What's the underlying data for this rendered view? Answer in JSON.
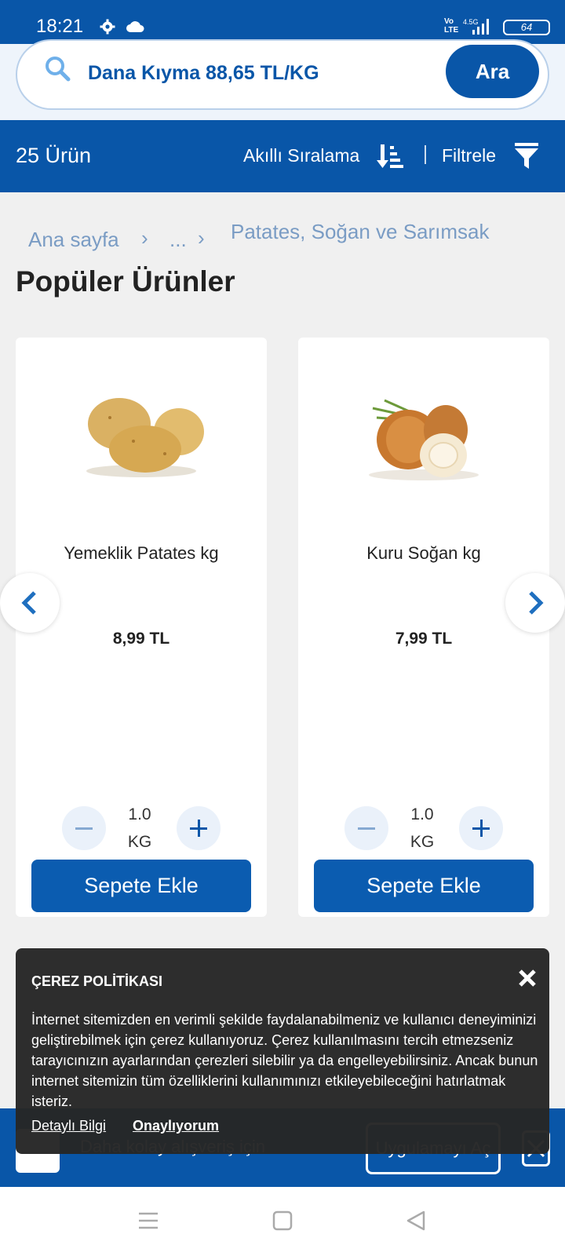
{
  "status": {
    "time": "18:21",
    "volte_top": "Vo",
    "volte_bottom": "LTE",
    "network": "4.5G",
    "battery": "64"
  },
  "search": {
    "query": "Dana Kıyma 88,65 TL/KG",
    "button": "Ara"
  },
  "toolbar": {
    "count": "25 Ürün",
    "sort": "Akıllı Sıralama",
    "filter": "Filtrele"
  },
  "breadcrumb": {
    "home": "Ana sayfa",
    "ellipsis": "...",
    "current": "Patates, Soğan ve Sarımsak"
  },
  "section_title": "Popüler Ürünler",
  "products": [
    {
      "name": "Yemeklik Patates kg",
      "price": "8,99 TL",
      "qty": "1.0",
      "unit": "KG",
      "add": "Sepete Ekle",
      "image": "potato-image"
    },
    {
      "name": "Kuru Soğan kg",
      "price": "7,99 TL",
      "qty": "1.0",
      "unit": "KG",
      "add": "Sepete Ekle",
      "image": "onion-image"
    }
  ],
  "cookie": {
    "title": "ÇEREZ POLİTİKASI",
    "text": "İnternet sitemizden en verimli şekilde faydalanabilmeniz ve kullanıcı deneyiminizi geliştirebilmek için çerez kullanıyoruz. Çerez kullanılmasını tercih etmezseniz tarayıcınızın ayarlarından çerezleri silebilir ya da engelleyebilirsiniz. Ancak bunun internet sitemizin tüm özelliklerini kullanımınızı etkileyebileceğini hatırlatmak isteriz.",
    "details": "Detaylı Bilgi",
    "accept": "Onaylıyorum"
  },
  "app_banner": {
    "text": "Daha kolay alışveriş için",
    "button": "Uygulamayı Aç"
  },
  "colors": {
    "brand": "#0956a8",
    "accent_light": "#eaf1fa"
  }
}
